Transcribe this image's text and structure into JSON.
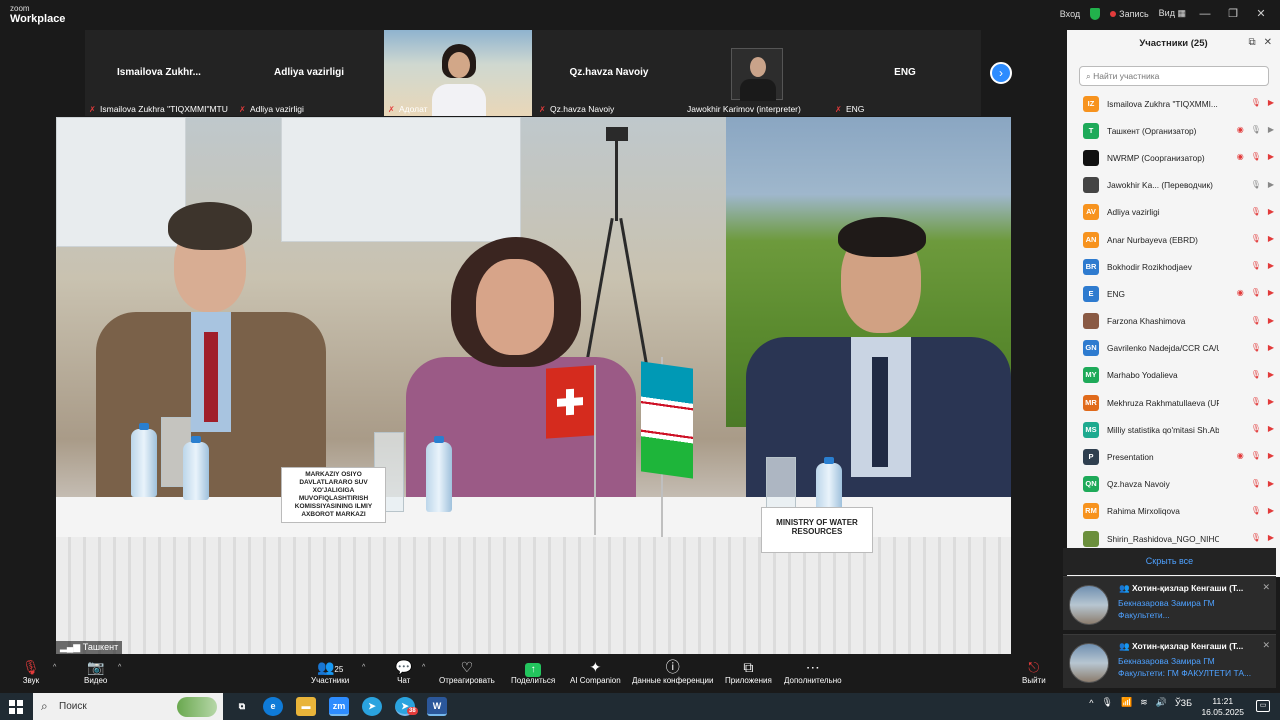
{
  "titlebar": {
    "brand_line1": "zoom",
    "brand_line2": "Workplace",
    "login": "Вход",
    "recording": "Запись",
    "view": "Вид"
  },
  "strip": {
    "tiles": [
      {
        "big": "Ismailova  Zukhr...",
        "label": "Ismailova Zukhra \"TIQXMMI\"MTU"
      },
      {
        "big": "Adliya vazirligi",
        "label": "Adliya vazirligi"
      },
      {
        "big": "",
        "label": "Адолат"
      },
      {
        "big": "Qz.havza Navoiy",
        "label": "Qz.havza Navoiy"
      },
      {
        "big": "",
        "label": "Jawokhir Karimov (interpreter)"
      },
      {
        "big": "ENG",
        "label": "ENG"
      }
    ]
  },
  "main_video": {
    "location_label": "Ташкент",
    "nameplate_left": "MARKAZIY OSIYO DAVLATLARARO SUV XO'JALIGIGA MUVOFIQLASHTIRISH KOMISSIYASINING ILMIY AXBOROT MARKAZI",
    "nameplate_right": "MINISTRY OF WATER RESOURCES"
  },
  "panel": {
    "title": "Участники (25)",
    "search_placeholder": "Найти участника",
    "participants": [
      {
        "initials": "IZ",
        "color": "#f7931e",
        "name": "Ismailova Zukhra \"TIQXMMI... (Я)"
      },
      {
        "initials": "T",
        "color": "#1eaa59",
        "name": "Ташкент (Организатор)"
      },
      {
        "initials": "",
        "color": "#111111",
        "name": "NWRMP (Соорганизатор)"
      },
      {
        "initials": "",
        "color": "#444444",
        "name": "Jawokhir Ka... (Переводчик)"
      },
      {
        "initials": "AV",
        "color": "#f7931e",
        "name": "Adliya vazirligi"
      },
      {
        "initials": "AN",
        "color": "#f7931e",
        "name": "Anar Nurbayeva (EBRD)"
      },
      {
        "initials": "BR",
        "color": "#2e7bcf",
        "name": "Bokhodir Rozikhodjaev"
      },
      {
        "initials": "E",
        "color": "#2e7bcf",
        "name": "ENG"
      },
      {
        "initials": "",
        "color": "#8a5a44",
        "name": "Farzona Khashimova"
      },
      {
        "initials": "GN",
        "color": "#2e7bcf",
        "name": "Gavrilenko Nadejda/CCR CA/U..."
      },
      {
        "initials": "MY",
        "color": "#1eaa59",
        "name": "Marhabo Yodalieva"
      },
      {
        "initials": "MR",
        "color": "#e06a1b",
        "name": "Mekhruza Rakhmatullaeva (UR..."
      },
      {
        "initials": "MS",
        "color": "#1eaa8f",
        "name": "Milliy statistika qo'mitasi Sh.Ab..."
      },
      {
        "initials": "P",
        "color": "#2f3f4f",
        "name": "Presentation"
      },
      {
        "initials": "QN",
        "color": "#1eaa59",
        "name": "Qz.havza Navoiy"
      },
      {
        "initials": "RM",
        "color": "#f7931e",
        "name": "Rahima Mirxoliqova"
      },
      {
        "initials": "",
        "color": "#6b8f3c",
        "name": "Shirin_Rashidova_NGO_NIHOL"
      }
    ],
    "hide_all": "Скрыть все"
  },
  "notifications": [
    {
      "title": "Хотин-қизлар Кенгаши (Т...",
      "body": "Бекназарова Замира ГМ Факультети..."
    },
    {
      "title": "Хотин-қизлар Кенгаши (Т...",
      "body": "Бекназарова Замира ГМ Факультети: ГМ ФАКУЛТЕТИ ТА..."
    }
  ],
  "toolbar": {
    "audio": "Звук",
    "video": "Видео",
    "participants": "Участники",
    "participants_count": "25",
    "chat": "Чат",
    "react": "Отреагировать",
    "share": "Поделиться",
    "ai": "AI Companion",
    "meeting_data": "Данные конференции",
    "apps": "Приложения",
    "more": "Дополнительно",
    "leave": "Выйти"
  },
  "taskbar": {
    "search": "Поиск",
    "lang": "ЎЗБ",
    "time": "11:21",
    "date": "16.05.2025",
    "telegram_badge": "38"
  }
}
